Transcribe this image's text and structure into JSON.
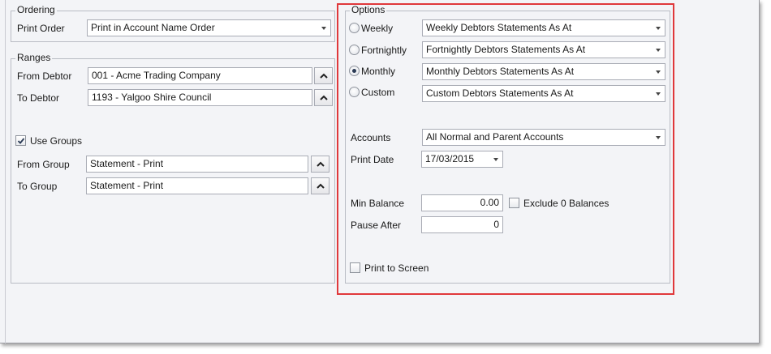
{
  "ordering": {
    "legend": "Ordering",
    "print_order_label": "Print Order",
    "print_order_value": "Print in Account Name Order"
  },
  "ranges": {
    "legend": "Ranges",
    "from_debtor_label": "From Debtor",
    "from_debtor_value": "001 - Acme Trading Company",
    "to_debtor_label": "To Debtor",
    "to_debtor_value": "1193 - Yalgoo Shire Council",
    "use_groups_label": "Use Groups",
    "use_groups_checked": true,
    "from_group_label": "From Group",
    "from_group_value": "Statement - Print",
    "to_group_label": "To Group",
    "to_group_value": "Statement - Print"
  },
  "options": {
    "legend": "Options",
    "frequencies": [
      {
        "label": "Weekly",
        "value": "Weekly Debtors Statements As At",
        "selected": false
      },
      {
        "label": "Fortnightly",
        "value": "Fortnightly Debtors Statements As At",
        "selected": false
      },
      {
        "label": "Monthly",
        "value": "Monthly Debtors Statements As At",
        "selected": true
      },
      {
        "label": "Custom",
        "value": "Custom Debtors Statements As At",
        "selected": false
      }
    ],
    "accounts_label": "Accounts",
    "accounts_value": "All Normal and Parent Accounts",
    "print_date_label": "Print Date",
    "print_date_value": "17/03/2015",
    "min_balance_label": "Min Balance",
    "min_balance_value": "0.00",
    "exclude_zero_label": "Exclude 0 Balances",
    "exclude_zero_checked": false,
    "pause_after_label": "Pause After",
    "pause_after_value": "0",
    "print_to_screen_label": "Print to Screen",
    "print_to_screen_checked": false
  },
  "colors": {
    "highlight": "#e0383b",
    "panel_bg": "#f3f4f7"
  }
}
